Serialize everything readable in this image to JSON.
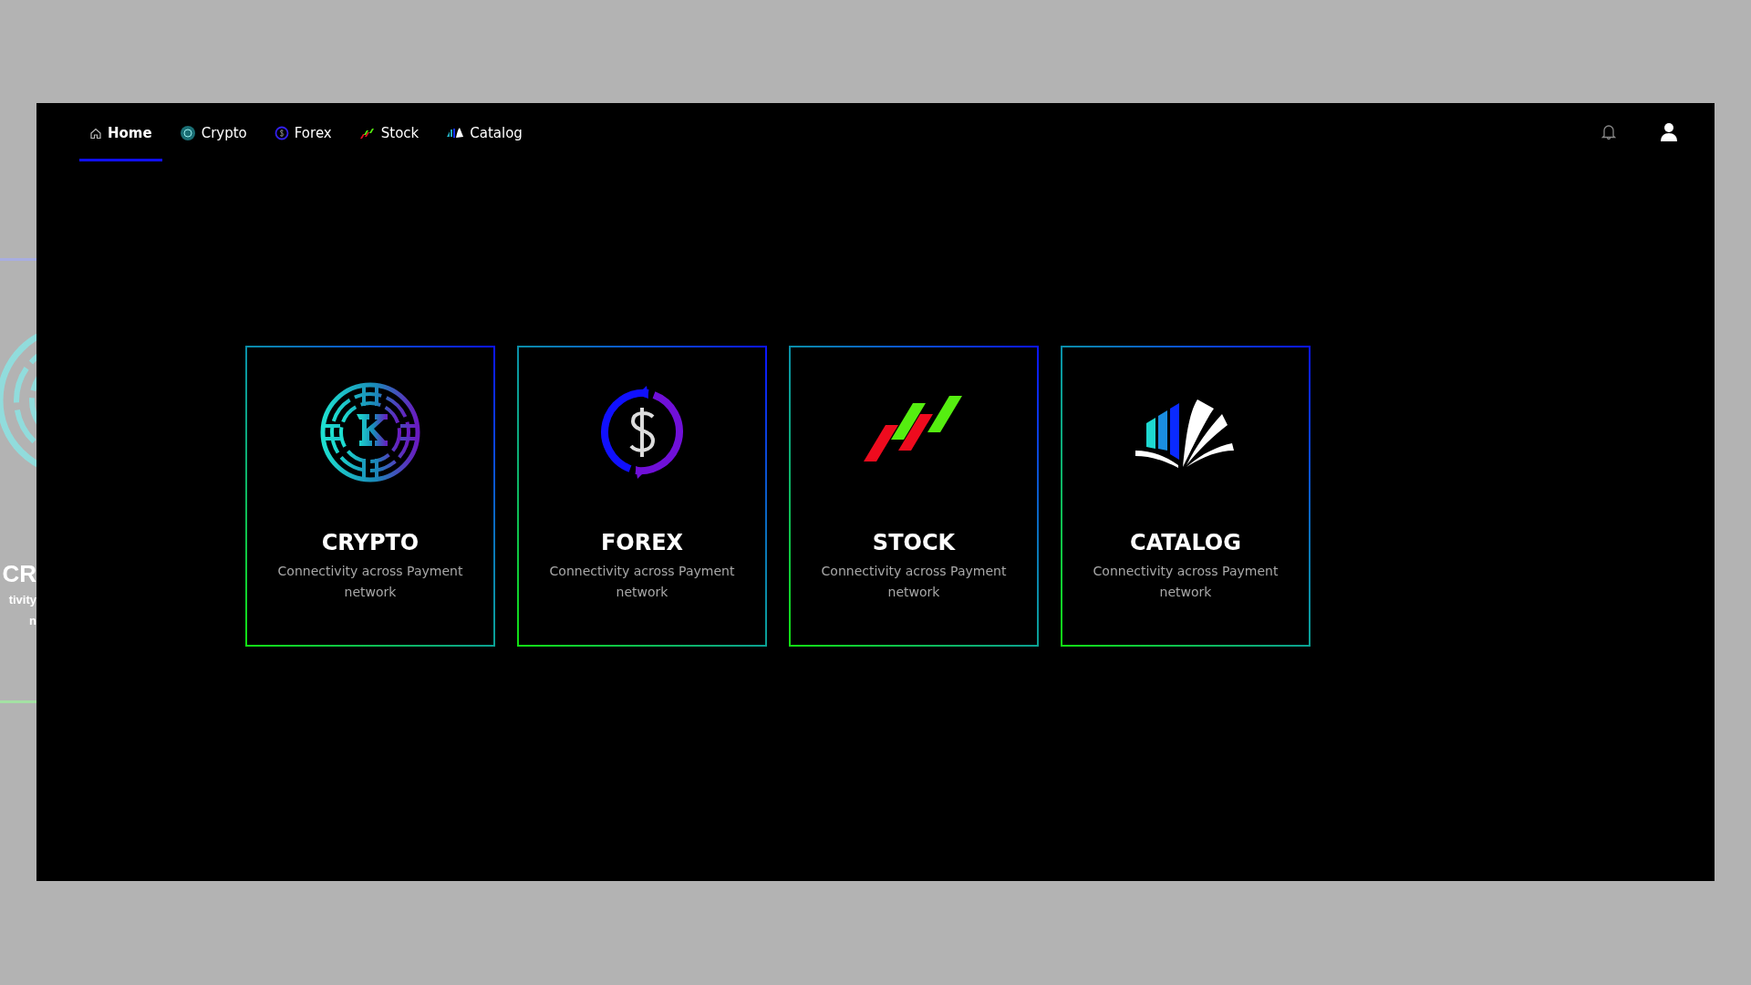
{
  "background_card": {
    "title": "CR",
    "line_1": "tivity",
    "line_2": "n"
  },
  "nav": {
    "items": [
      {
        "kind": "home",
        "label": "Home",
        "selected": true
      },
      {
        "kind": "crypto",
        "label": "Crypto",
        "selected": false
      },
      {
        "kind": "forex",
        "label": "Forex",
        "selected": false
      },
      {
        "kind": "stock",
        "label": "Stock",
        "selected": false
      },
      {
        "kind": "catalog",
        "label": "Catalog",
        "selected": false
      }
    ]
  },
  "cards": [
    {
      "kind": "crypto",
      "title": "CRYPTO",
      "description": "Connectivity across Payment network"
    },
    {
      "kind": "forex",
      "title": "FOREX",
      "description": "Connectivity across Payment network"
    },
    {
      "kind": "stock",
      "title": "STOCK",
      "description": "Connectivity across Payment network"
    },
    {
      "kind": "catalog",
      "title": "CATALOG",
      "description": "Connectivity across Payment network"
    }
  ]
}
